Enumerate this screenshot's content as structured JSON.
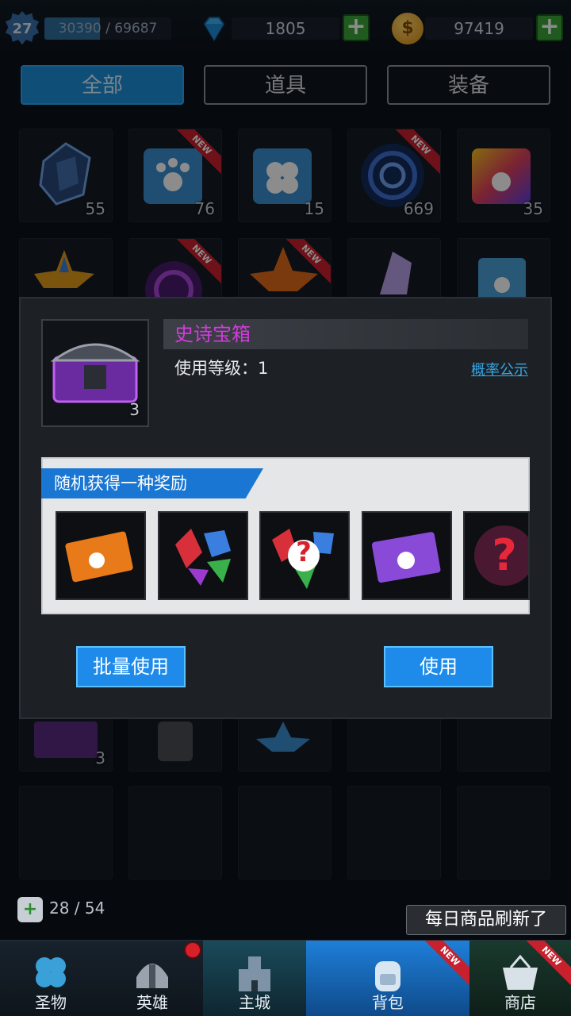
{
  "player": {
    "level": "27",
    "xp": "30390 / 69687",
    "xp_progress": 0.436
  },
  "resources": {
    "gems": "1805",
    "coins": "97419"
  },
  "colors": {
    "accent": "#1d8fd8",
    "epic": "#d23bdc",
    "link": "#36a6e4"
  },
  "tabs": [
    {
      "label": "全部",
      "active": true
    },
    {
      "label": "道具"
    },
    {
      "label": "装备"
    }
  ],
  "inventory_counts": [
    "55",
    "76",
    "15",
    "669",
    "35"
  ],
  "new_badge": "NEW",
  "dialog": {
    "item_name": "史诗宝箱",
    "item_count": "3",
    "use_level": "使用等级：1",
    "probability_link": "概率公示",
    "reward_header": "随机获得一种奖励",
    "rewards": [
      {
        "icon": "orange-paw-ticket-icon"
      },
      {
        "icon": "gem-bundle-icon"
      },
      {
        "icon": "random-gem-icon",
        "mark": "?"
      },
      {
        "icon": "purple-paw-ticket-icon"
      },
      {
        "icon": "mystery-icon",
        "mark": "?"
      }
    ],
    "batch_use_label": "批量使用",
    "use_label": "使用"
  },
  "behind": {
    "chest_count": "3"
  },
  "bag": {
    "count": "28 / 54"
  },
  "toast": "每日商品刷新了",
  "nav": [
    {
      "label": "圣物"
    },
    {
      "label": "英雄"
    },
    {
      "label": "主城"
    },
    {
      "label": "背包"
    },
    {
      "label": "商店"
    }
  ]
}
